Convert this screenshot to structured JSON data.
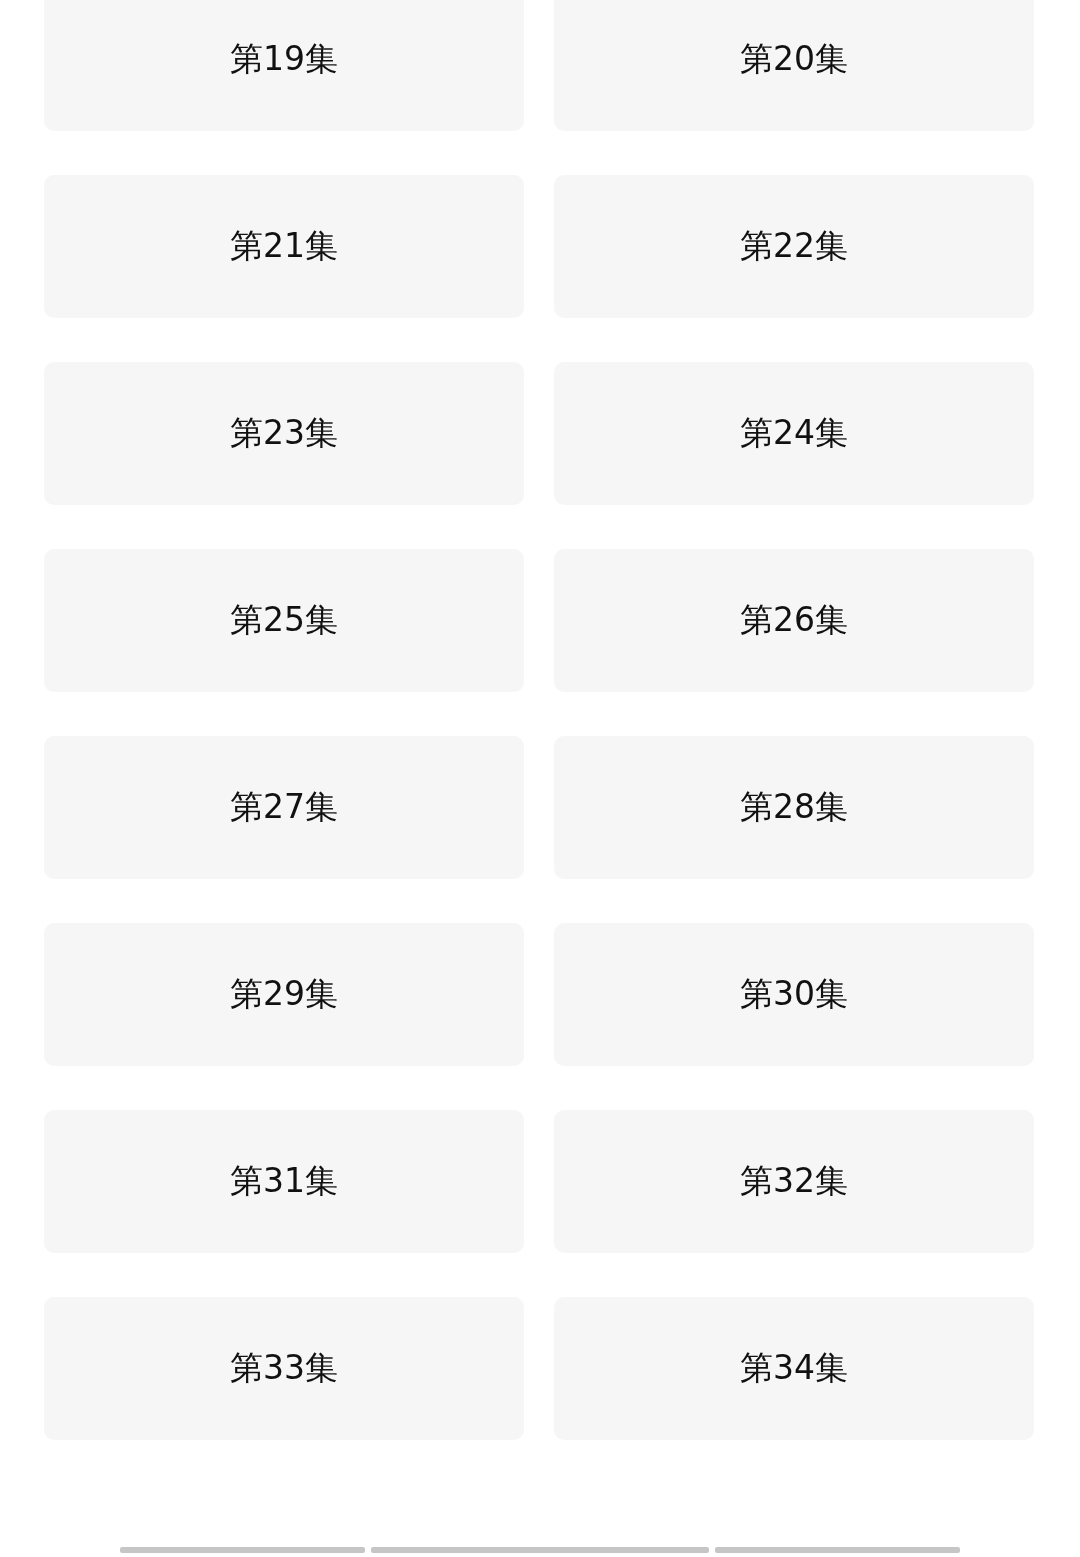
{
  "episodes": [
    {
      "label": "第19集"
    },
    {
      "label": "第20集"
    },
    {
      "label": "第21集"
    },
    {
      "label": "第22集"
    },
    {
      "label": "第23集"
    },
    {
      "label": "第24集"
    },
    {
      "label": "第25集"
    },
    {
      "label": "第26集"
    },
    {
      "label": "第27集"
    },
    {
      "label": "第28集"
    },
    {
      "label": "第29集"
    },
    {
      "label": "第30集"
    },
    {
      "label": "第31集"
    },
    {
      "label": "第32集"
    },
    {
      "label": "第33集"
    },
    {
      "label": "第34集"
    }
  ]
}
